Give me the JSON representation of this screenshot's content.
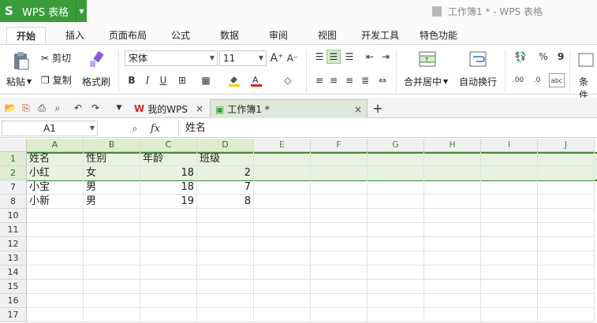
{
  "app": {
    "name": "WPS 表格",
    "logo": "S",
    "doc_title": "工作簿1 * - WPS 表格"
  },
  "tabs": [
    "开始",
    "插入",
    "页面布局",
    "公式",
    "数据",
    "审阅",
    "视图",
    "开发工具",
    "特色功能"
  ],
  "ribbon": {
    "paste": "粘贴",
    "cut": "剪切",
    "copy": "复制",
    "format_painter": "格式刷",
    "font_name": "宋体",
    "font_size": "11",
    "merge_center": "合并居中",
    "wrap_text": "自动换行",
    "conditional": "条件",
    "percent": "%",
    "comma": "9"
  },
  "doc_tabs": [
    {
      "label": "我的WPS",
      "close": "×"
    },
    {
      "label": "工作簿1 *",
      "close": "×"
    }
  ],
  "new_tab": "+",
  "formula_bar": {
    "name_box": "A1",
    "fx": "fx",
    "content": "姓名"
  },
  "columns": [
    "A",
    "B",
    "C",
    "D",
    "E",
    "F",
    "G",
    "H",
    "I",
    "J"
  ],
  "rows": [
    {
      "num": "1",
      "cells": [
        "姓名",
        "性别",
        "年龄",
        "班级"
      ]
    },
    {
      "num": "2",
      "cells": [
        "小红",
        "女",
        "18",
        "2"
      ]
    },
    {
      "num": "7",
      "cells": [
        "小宝",
        "男",
        "18",
        "7"
      ]
    },
    {
      "num": "8",
      "cells": [
        "小新",
        "男",
        "19",
        "8"
      ]
    },
    {
      "num": "10",
      "cells": []
    },
    {
      "num": "11",
      "cells": []
    },
    {
      "num": "12",
      "cells": []
    },
    {
      "num": "13",
      "cells": []
    },
    {
      "num": "14",
      "cells": []
    },
    {
      "num": "15",
      "cells": []
    },
    {
      "num": "16",
      "cells": []
    },
    {
      "num": "17",
      "cells": []
    }
  ],
  "colors": {
    "accent": "#3a9b3a",
    "selection": "#e8f3df",
    "header_green": "#4a8c3a"
  }
}
